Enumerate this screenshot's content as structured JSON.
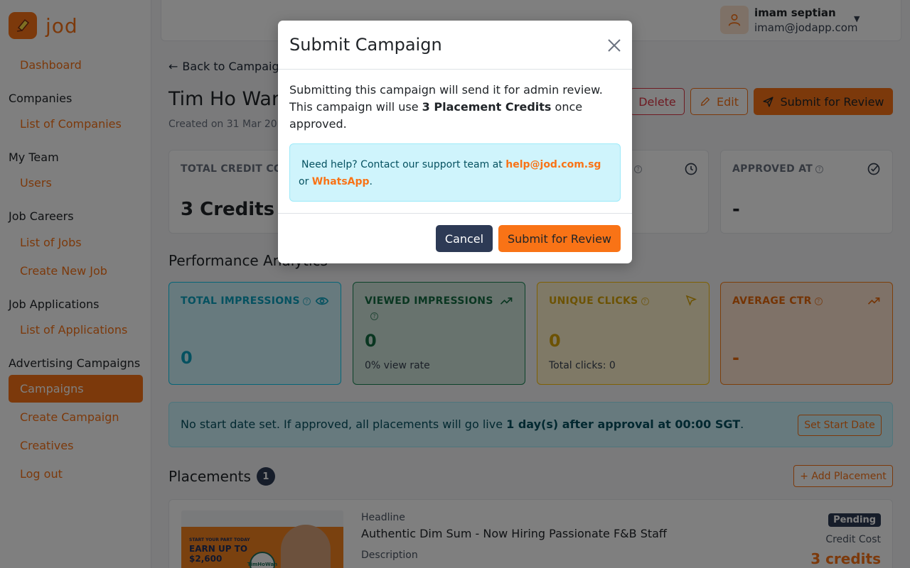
{
  "brand": {
    "name": "jod"
  },
  "sidebar": {
    "dashboard": "Dashboard",
    "companies_section": "Companies",
    "list_of_companies": "List of Companies",
    "my_team_section": "My Team",
    "users": "Users",
    "job_careers_section": "Job Careers",
    "list_of_jobs": "List of Jobs",
    "create_new_job": "Create New Job",
    "job_applications_section": "Job Applications",
    "list_of_applications": "List of Applications",
    "advertising_section": "Advertising Campaigns",
    "campaigns": "Campaigns",
    "create_campaign": "Create Campaign",
    "creatives": "Creatives",
    "logout": "Log out"
  },
  "user": {
    "name": "imam septian",
    "email": "imam@jodapp.com"
  },
  "page": {
    "back_link": "Back to Campaigns",
    "title": "Tim Ho Wan",
    "meta": "Created on 31 Mar 20",
    "delete_label": "Delete",
    "edit_label": "Edit",
    "submit_label": "Submit for Review"
  },
  "cards": {
    "total_credit_label": "TOTAL CREDIT CO",
    "total_credit_value": "3 Credits",
    "approved_at_label": "APPROVED AT",
    "approved_at_value": "-"
  },
  "analytics": {
    "title": "Performance Analytics",
    "total_impressions": {
      "label": "TOTAL IMPRESSIONS",
      "value": "0"
    },
    "viewed_impressions": {
      "label": "VIEWED IMPRESSIONS",
      "value": "0",
      "sub": "0% view rate"
    },
    "unique_clicks": {
      "label": "UNIQUE CLICKS",
      "value": "0",
      "sub": "Total clicks: 0"
    },
    "average_ctr": {
      "label": "AVERAGE CTR",
      "value": "-"
    }
  },
  "notice": {
    "text_before": "No start date set. If approved, all placements will go live ",
    "text_bold": "1 day(s) after approval at 00:00 SGT",
    "text_after": ".",
    "button": "Set Start Date"
  },
  "placements": {
    "title": "Placements",
    "count": "1",
    "add_button": "+ Add Placement",
    "item": {
      "headline_label": "Headline",
      "headline": "Authentic Dim Sum - Now Hiring Passionate F&B Staff",
      "description_label": "Description",
      "status": "Pending",
      "credit_cost_label": "Credit Cost",
      "credit_cost": "3 credits",
      "thumb_line1": "START YOUR PART TODAY",
      "thumb_line2": "EARN UP TO",
      "thumb_line3": "$2,600",
      "thumb_logo": "TimHoWan"
    }
  },
  "modal": {
    "title": "Submit Campaign",
    "body_line1": "Submitting this campaign will send it for admin review.",
    "body_line2_before": "This campaign will use ",
    "body_line2_bold": "3 Placement Credits",
    "body_line2_after": " once approved.",
    "help_before": "Need help? Contact our support team at ",
    "help_email": "help@jod.com.sg",
    "help_middle": " or ",
    "help_whatsapp": "WhatsApp",
    "help_after": ".",
    "cancel": "Cancel",
    "submit": "Submit for Review"
  },
  "colors": {
    "accent": "#f97316",
    "navy": "#2d3a55",
    "info_bg": "#cff4fc",
    "info_text": "#055160",
    "teal_metric": "#0dcaf0",
    "green_metric": "#198754",
    "yellow_metric": "#ffc107",
    "orange_metric": "#fd7e14"
  }
}
